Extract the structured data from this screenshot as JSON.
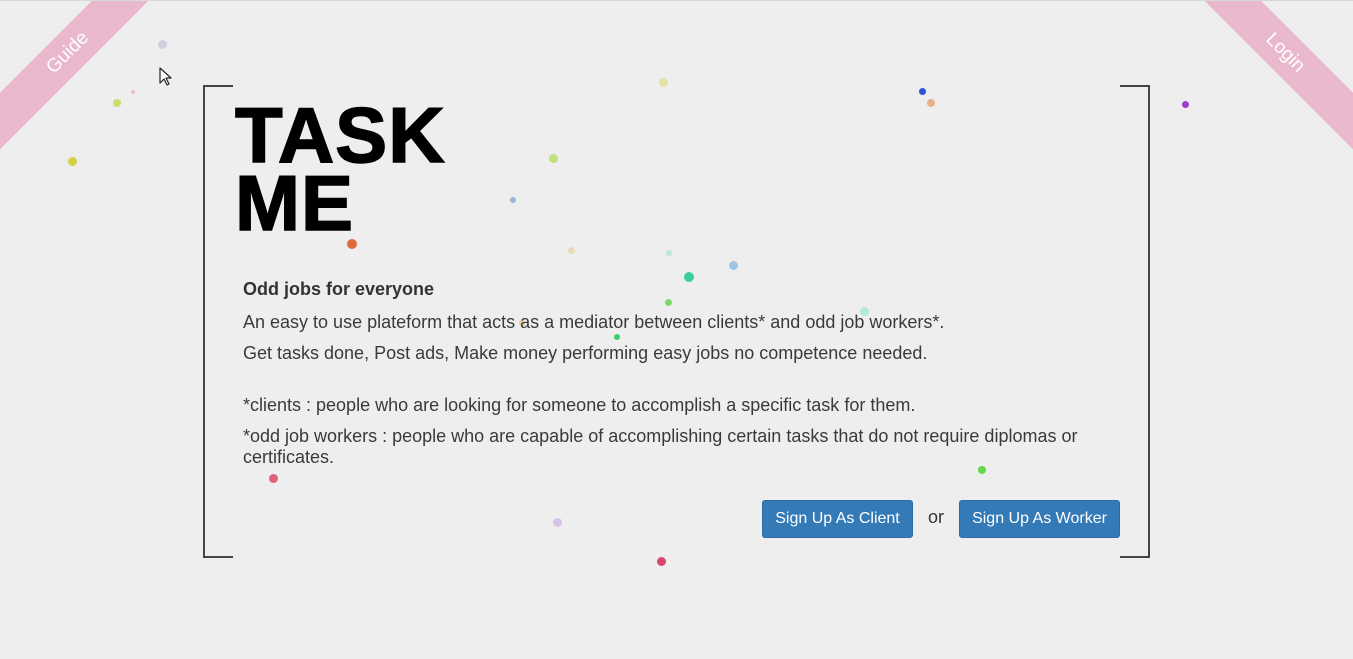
{
  "ribbons": {
    "left_label": "Guide",
    "right_label": "Login"
  },
  "logo": {
    "line1": "TASK",
    "line2": "ME"
  },
  "main": {
    "tagline": "Odd jobs for everyone",
    "description1": "An easy to use plateform that acts as a mediator between clients* and odd job workers*.",
    "description2": "Get tasks done, Post ads, Make money performing easy jobs no competence needed.",
    "note_clients": "*clients : people who are looking for someone to accomplish a specific task for them.",
    "note_workers": "*odd job workers : people who are capable of accomplishing certain tasks that do not require diplomas or certificates."
  },
  "actions": {
    "client_button": "Sign Up As Client",
    "separator": "or",
    "worker_button": "Sign Up As Worker"
  },
  "colors": {
    "ribbon": "#eab8cc",
    "button": "#337ab7",
    "background": "#eeeeee"
  }
}
